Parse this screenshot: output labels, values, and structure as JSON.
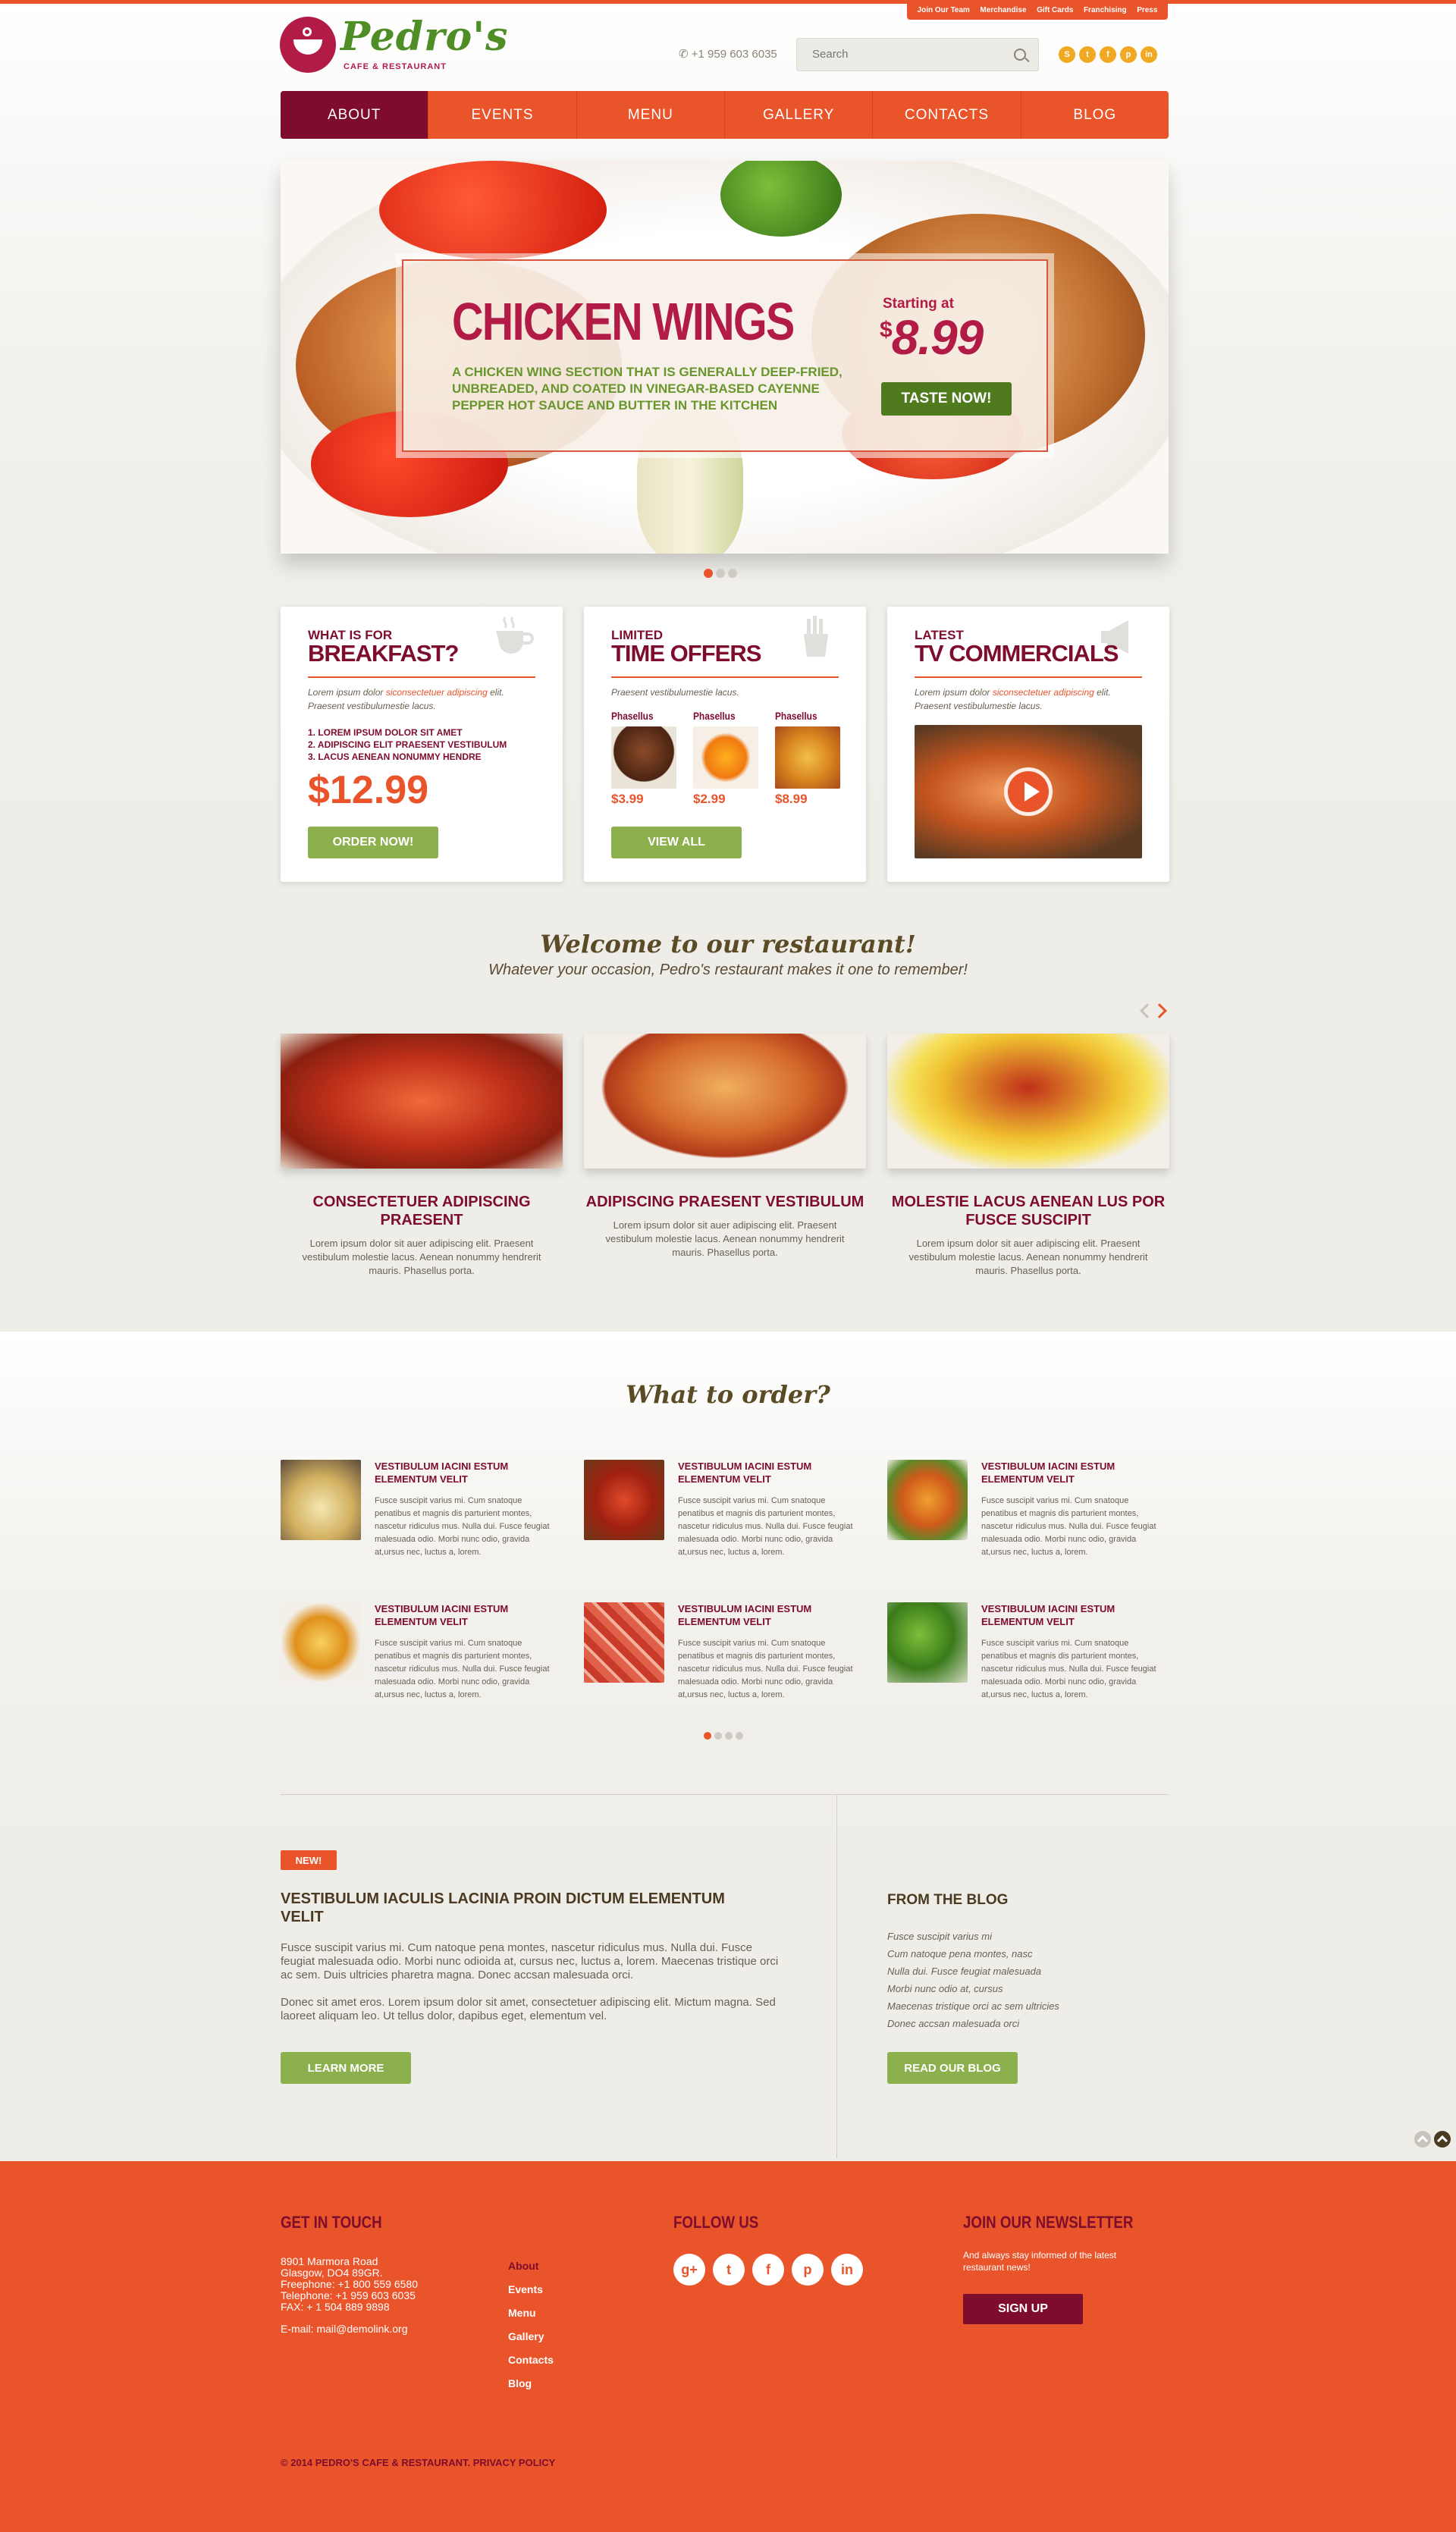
{
  "top_links": [
    "Join Our Team",
    "Merchandise",
    "Gift Cards",
    "Franchising",
    "Press"
  ],
  "logo": {
    "name": "Pedro's",
    "tagline": "CAFE & RESTAURANT"
  },
  "header": {
    "phone": "+1 959 603 6035",
    "search_placeholder": "Search"
  },
  "social_top": [
    "S",
    "t",
    "f",
    "p",
    "in"
  ],
  "nav": [
    "ABOUT",
    "EVENTS",
    "MENU",
    "GALLERY",
    "CONTACTS",
    "BLOG"
  ],
  "slide": {
    "title": "CHICKEN WINGS",
    "description": "A chicken wing section that is generally deep-fried, unbreaded, and coated in vinegar-based cayenne pepper hot sauce and butter in the kitchen",
    "starting_label": "Starting at",
    "currency": "$",
    "price": "8.99",
    "button": "TASTE NOW!"
  },
  "cards": {
    "breakfast": {
      "kicker": "WHAT IS FOR",
      "heading": "BREAKFAST?",
      "text_prefix": "Lorem ipsum dolor ",
      "text_link": "siconsectetuer adipiscing",
      "text_suffix": " elit. Praesent vestibulumestie lacus.",
      "items": [
        "1. LOREM IPSUM DOLOR SIT AMET",
        "2. ADIPISCING ELIT PRAESENT VESTIBULUM",
        "3. LACUS AENEAN NONUMMY HENDRE"
      ],
      "price": "$12.99",
      "button": "ORDER NOW!"
    },
    "offers": {
      "kicker": "LIMITED",
      "heading": "TIME OFFERS",
      "text": "Praesent vestibulumestie lacus.",
      "items": [
        {
          "name": "Phasellus",
          "price": "$3.99"
        },
        {
          "name": "Phasellus",
          "price": "$2.99"
        },
        {
          "name": "Phasellus",
          "price": "$8.99"
        }
      ],
      "button": "VIEW ALL"
    },
    "tv": {
      "kicker": "LATEST",
      "heading": "TV COMMERCIALS",
      "text_prefix": "Lorem ipsum dolor ",
      "text_link": "siconsectetuer adipiscing",
      "text_suffix": " elit. Praesent vestibulumestie lacus."
    }
  },
  "welcome": {
    "title": "Welcome to our restaurant!",
    "subtitle": "Whatever your occasion, Pedro's restaurant makes it one to remember!"
  },
  "features": [
    {
      "title": "CONSECTETUER ADIPISCING PRAESENT",
      "text": "Lorem ipsum dolor sit auer adipiscing elit. Praesent vestibulum molestie lacus. Aenean nonummy hendrerit mauris. Phasellus porta."
    },
    {
      "title": "ADIPISCING PRAESENT VESTIBULUM",
      "text": "Lorem ipsum dolor sit auer adipiscing elit. Praesent vestibulum molestie lacus. Aenean nonummy hendrerit mauris. Phasellus porta."
    },
    {
      "title": "MOLESTIE LACUS AENEAN LUS POR FUSCE SUSCIPIT",
      "text": "Lorem ipsum dolor sit auer adipiscing elit. Praesent vestibulum molestie lacus. Aenean nonummy hendrerit mauris. Phasellus porta."
    }
  ],
  "what_to_order": {
    "title": "What to order?",
    "items": [
      {
        "title": "VESTIBULUM IACINI ESTUM ELEMENTUM VELIT",
        "text": "Fusce suscipit varius mi. Cum snatoque penatibus et magnis dis parturient montes, nascetur ridiculus mus. Nulla dui. Fusce feugiat malesuada odio. Morbi nunc odio, gravida at,ursus nec, luctus a, lorem."
      },
      {
        "title": "VESTIBULUM IACINI ESTUM ELEMENTUM VELIT",
        "text": "Fusce suscipit varius mi. Cum snatoque penatibus et magnis dis parturient montes, nascetur ridiculus mus. Nulla dui. Fusce feugiat malesuada odio. Morbi nunc odio, gravida at,ursus nec, luctus a, lorem."
      },
      {
        "title": "VESTIBULUM IACINI ESTUM ELEMENTUM VELIT",
        "text": "Fusce suscipit varius mi. Cum snatoque penatibus et magnis dis parturient montes, nascetur ridiculus mus. Nulla dui. Fusce feugiat malesuada odio. Morbi nunc odio, gravida at,ursus nec, luctus a, lorem."
      },
      {
        "title": "VESTIBULUM IACINI ESTUM ELEMENTUM VELIT",
        "text": "Fusce suscipit varius mi. Cum snatoque penatibus et magnis dis parturient montes, nascetur ridiculus mus. Nulla dui. Fusce feugiat malesuada odio. Morbi nunc odio, gravida at,ursus nec, luctus a, lorem."
      },
      {
        "title": "VESTIBULUM IACINI ESTUM ELEMENTUM VELIT",
        "text": "Fusce suscipit varius mi. Cum snatoque penatibus et magnis dis parturient montes, nascetur ridiculus mus. Nulla dui. Fusce feugiat malesuada odio. Morbi nunc odio, gravida at,ursus nec, luctus a, lorem."
      },
      {
        "title": "VESTIBULUM IACINI ESTUM ELEMENTUM VELIT",
        "text": "Fusce suscipit varius mi. Cum snatoque penatibus et magnis dis parturient montes, nascetur ridiculus mus. Nulla dui. Fusce feugiat malesuada odio. Morbi nunc odio, gravida at,ursus nec, luctus a, lorem."
      }
    ]
  },
  "news": {
    "tag": "NEW!",
    "title": "VESTIBULUM IACULIS LACINIA PROIN DICTUM ELEMENTUM VELIT",
    "p1": "Fusce suscipit varius mi. Cum natoque pena montes, nascetur ridiculus mus. Nulla dui. Fusce feugiat malesuada odio. Morbi nunc odioida at, cursus nec, luctus a, lorem. Maecenas tristique orci ac sem. Duis ultricies pharetra magna. Donec accsan malesuada orci.",
    "p2": "Donec sit amet eros. Lorem ipsum dolor sit amet, consectetuer adipiscing elit. Mictum magna. Sed laoreet aliquam leo. Ut tellus dolor, dapibus eget, elementum vel.",
    "button": "LEARN MORE"
  },
  "blog": {
    "title": "FROM THE BLOG",
    "items": [
      "Fusce suscipit varius mi",
      "Cum natoque pena montes, nasc",
      "Nulla dui. Fusce feugiat malesuada",
      "Morbi nunc odio at, cursus",
      "Maecenas tristique orci ac sem ultricies",
      "Donec accsan malesuada orci"
    ],
    "button": "READ OUR BLOG"
  },
  "footer": {
    "contact_title": "GET IN TOUCH",
    "address_lines": [
      "8901 Marmora Road",
      "Glasgow, DO4 89GR.",
      "Freephone:  +1 800 559 6580",
      "Telephone:   +1 959 603 6035",
      "FAX:            + 1 504 889 9898"
    ],
    "email": "E-mail: mail@demolink.org",
    "menu": [
      "About",
      "Events",
      "Menu",
      "Gallery",
      "Contacts",
      "Blog"
    ],
    "follow_title": "FOLLOW US",
    "follow_icons": [
      "g+",
      "t",
      "f",
      "p",
      "in"
    ],
    "newsletter_title": "JOIN OUR NEWSLETTER",
    "newsletter_text": "And always stay informed of the latest restaurant news!",
    "signup": "SIGN UP",
    "copyright": "© 2014 PEDRO'S CAFE & RESTAURANT.",
    "privacy": "PRIVACY POLICY"
  }
}
